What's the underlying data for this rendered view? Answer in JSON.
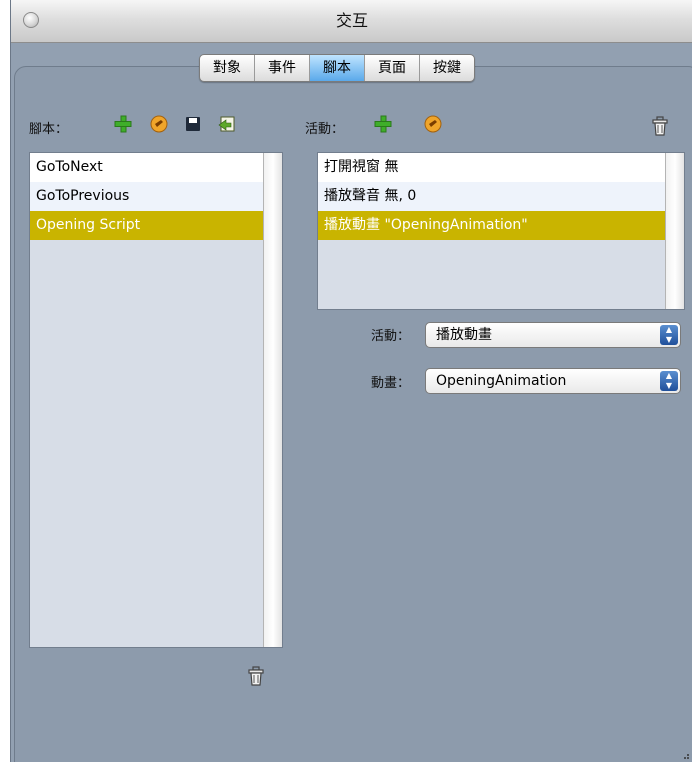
{
  "window": {
    "title": "交互"
  },
  "tabs": [
    {
      "label": "對象",
      "active": false
    },
    {
      "label": "事件",
      "active": false
    },
    {
      "label": "腳本",
      "active": true
    },
    {
      "label": "頁面",
      "active": false
    },
    {
      "label": "按鍵",
      "active": false
    }
  ],
  "scripts_panel": {
    "label": "腳本：",
    "toolbar_icons": [
      "add-icon",
      "link-icon",
      "save-icon",
      "import-icon"
    ],
    "items": [
      {
        "label": "GoToNext",
        "selected": false
      },
      {
        "label": "GoToPrevious",
        "selected": false
      },
      {
        "label": "Opening Script",
        "selected": true
      }
    ],
    "trash_icon": "trash-icon"
  },
  "actions_panel": {
    "label": "活動：",
    "toolbar_icons": [
      "add-icon",
      "link-icon"
    ],
    "trash_icon": "trash-icon",
    "items": [
      {
        "label": "打開視窗  無",
        "selected": false
      },
      {
        "label": "播放聲音  無, 0",
        "selected": false
      },
      {
        "label": "播放動畫  \"OpeningAnimation\"",
        "selected": true
      }
    ]
  },
  "action_field": {
    "label": "活動：",
    "value": "播放動畫"
  },
  "animation_field": {
    "label": "動畫：",
    "value": "OpeningAnimation"
  },
  "colors": {
    "selection": "#c9b400",
    "accent": "#5aa9ea",
    "panel": "#8d9bac"
  }
}
